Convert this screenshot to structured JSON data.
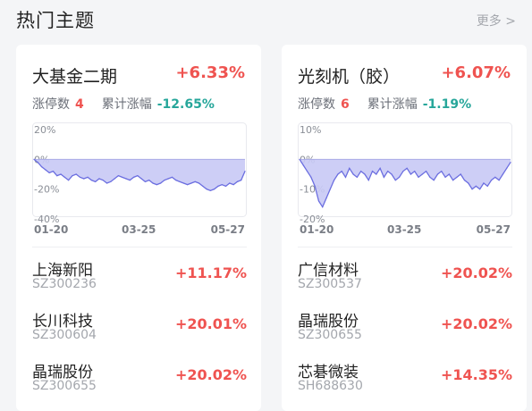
{
  "header": {
    "title": "热门主题",
    "more": "更多 >"
  },
  "cards": [
    {
      "name": "大基金二期",
      "change": "+6.33%",
      "limit_up_label": "涨停数",
      "limit_up_count": "4",
      "cum_label": "累计涨幅",
      "cum_value": "-12.65%",
      "y_ticks": [
        "20%",
        "0%",
        "-20%",
        "-40%"
      ],
      "x_ticks": [
        "01-20",
        "03-25",
        "05-27"
      ],
      "stocks": [
        {
          "name": "上海新阳",
          "code": "SZ300236",
          "change": "+11.17%"
        },
        {
          "name": "长川科技",
          "code": "SZ300604",
          "change": "+20.01%"
        },
        {
          "name": "晶瑞股份",
          "code": "SZ300655",
          "change": "+20.02%"
        }
      ]
    },
    {
      "name": "光刻机（胶）",
      "change": "+6.07%",
      "limit_up_label": "涨停数",
      "limit_up_count": "6",
      "cum_label": "累计涨幅",
      "cum_value": "-1.19%",
      "y_ticks": [
        "10%",
        "0%",
        "-10%",
        "-20%"
      ],
      "x_ticks": [
        "01-20",
        "03-25",
        "05-27"
      ],
      "stocks": [
        {
          "name": "广信材料",
          "code": "SZ300537",
          "change": "+20.02%"
        },
        {
          "name": "晶瑞股份",
          "code": "SZ300655",
          "change": "+20.02%"
        },
        {
          "name": "芯碁微装",
          "code": "SH688630",
          "change": "+14.35%"
        }
      ]
    }
  ],
  "chart_data": [
    {
      "type": "area",
      "x": [
        "01-20",
        "03-25",
        "05-27"
      ],
      "ylim": [
        -40,
        20
      ],
      "y_ticks": [
        20,
        0,
        -20,
        -40
      ],
      "series": [
        {
          "values": [
            0,
            -2,
            -5,
            -7,
            -9,
            -8,
            -11,
            -10,
            -12,
            -14,
            -11,
            -10,
            -12,
            -13,
            -12,
            -14,
            -15,
            -13,
            -14,
            -16,
            -15,
            -13,
            -11,
            -12,
            -13,
            -14,
            -12,
            -11,
            -13,
            -15,
            -14,
            -16,
            -17,
            -16,
            -14,
            -13,
            -12,
            -14,
            -15,
            -16,
            -17,
            -16,
            -15,
            -16,
            -18,
            -20,
            -21,
            -20,
            -18,
            -17,
            -18,
            -16,
            -17,
            -15,
            -14,
            -8
          ]
        }
      ],
      "colors": {
        "line": "#6b6ee0",
        "fill": "#c8c9f5"
      }
    },
    {
      "type": "area",
      "x": [
        "01-20",
        "03-25",
        "05-27"
      ],
      "ylim": [
        -20,
        10
      ],
      "y_ticks": [
        10,
        0,
        -10,
        -20
      ],
      "series": [
        {
          "values": [
            0,
            -2,
            -4,
            -6,
            -9,
            -14,
            -16,
            -13,
            -10,
            -7,
            -5,
            -4,
            -6,
            -3,
            -5,
            -6,
            -4,
            -5,
            -7,
            -4,
            -5,
            -3,
            -6,
            -4,
            -5,
            -7,
            -6,
            -4,
            -3,
            -5,
            -4,
            -6,
            -5,
            -4,
            -6,
            -7,
            -5,
            -4,
            -6,
            -5,
            -7,
            -6,
            -5,
            -7,
            -8,
            -10,
            -9,
            -10,
            -8,
            -9,
            -7,
            -6,
            -7,
            -5,
            -3,
            -1
          ]
        }
      ],
      "colors": {
        "line": "#6b6ee0",
        "fill": "#c8c9f5"
      }
    }
  ]
}
